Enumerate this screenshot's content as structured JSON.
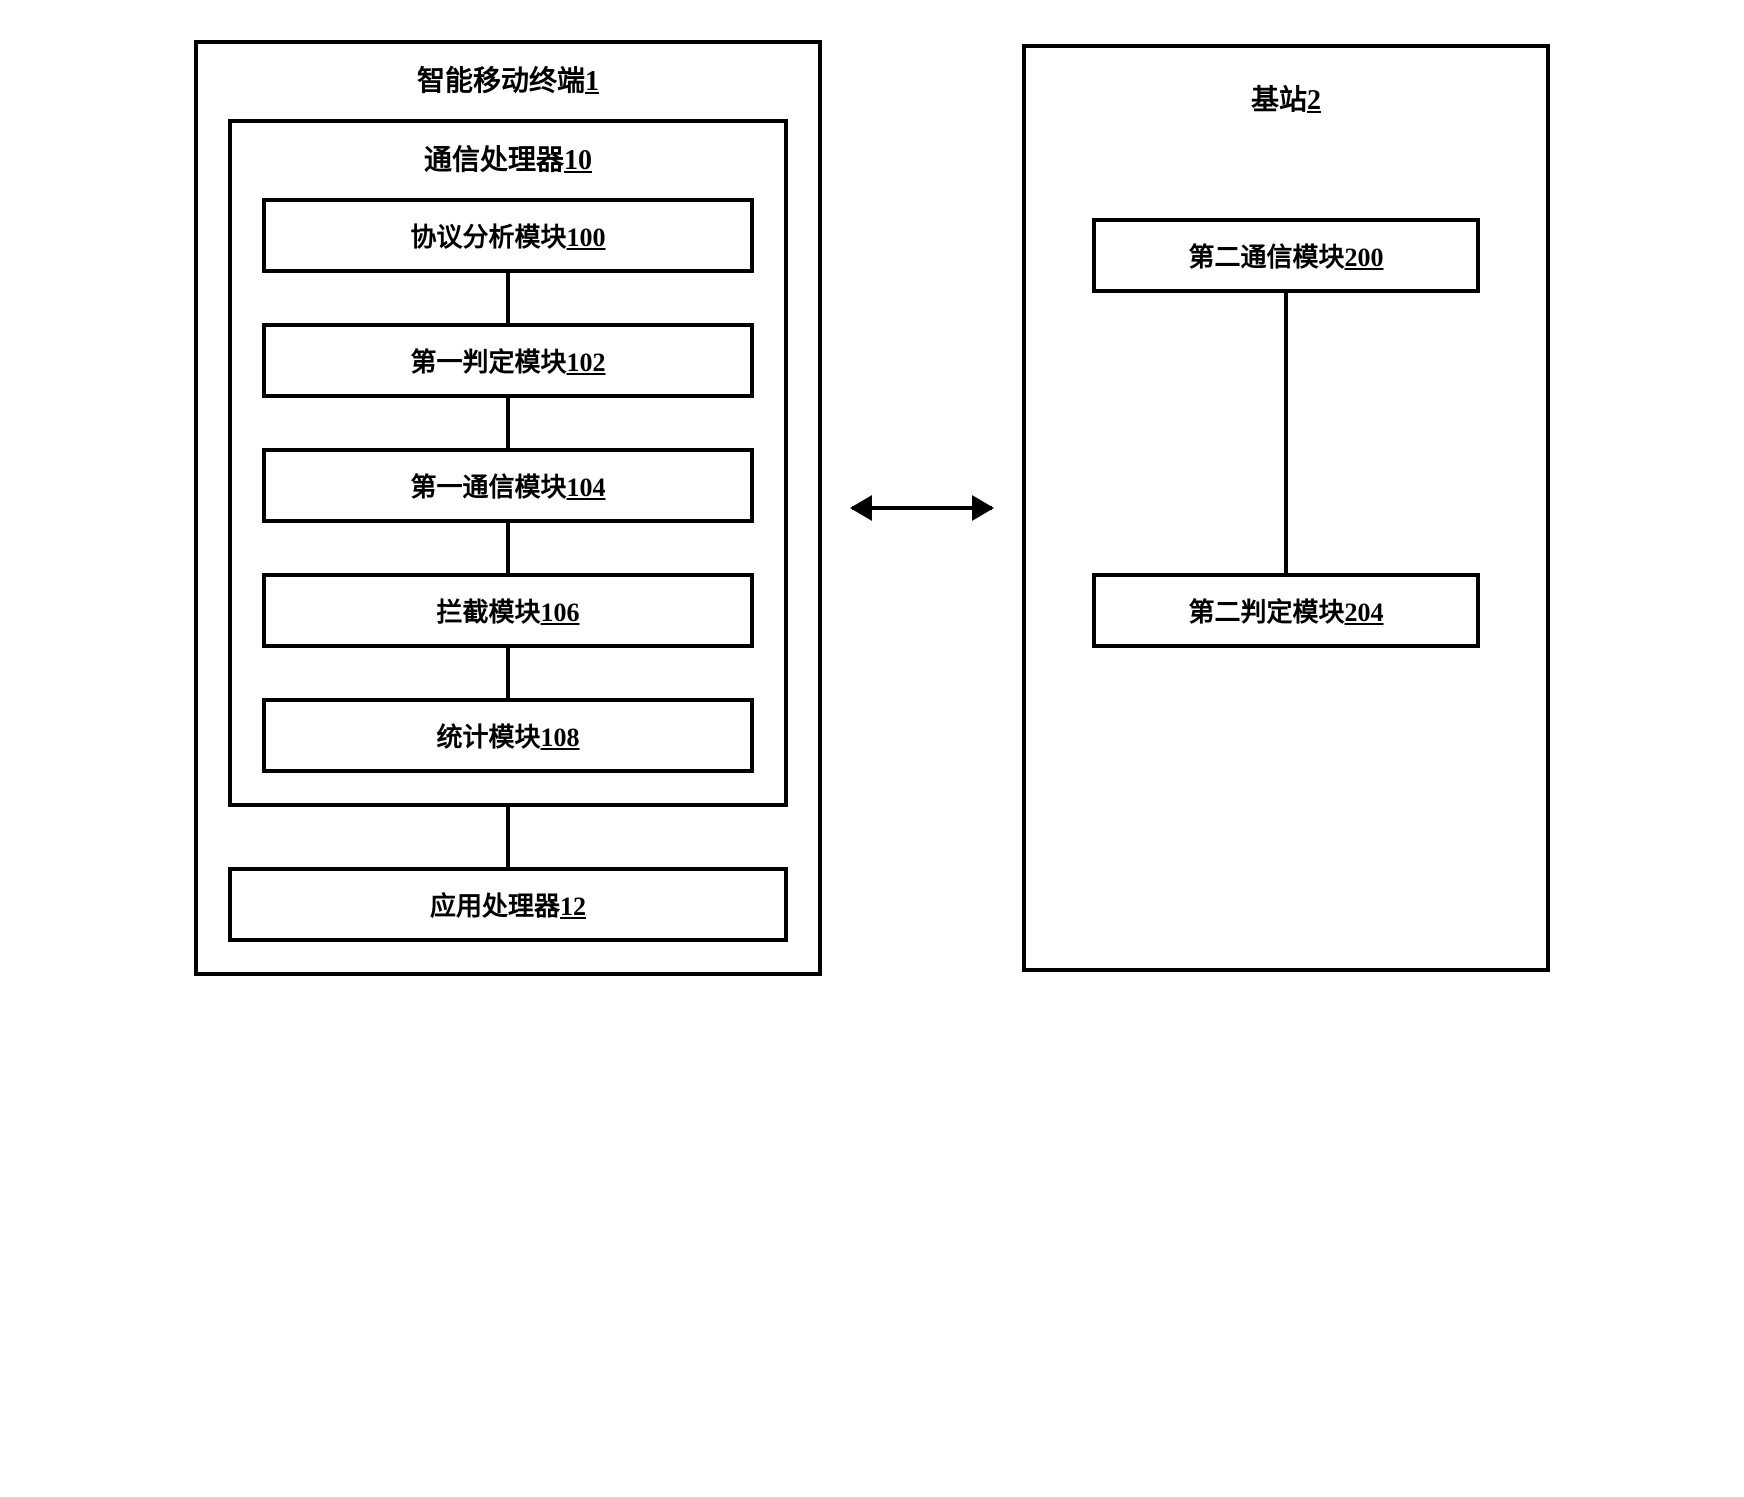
{
  "terminal": {
    "title": "智能移动终端",
    "title_num": "1",
    "processor": {
      "title": "通信处理器",
      "title_num": "10",
      "modules": [
        {
          "label": "协议分析模块",
          "num": "100"
        },
        {
          "label": "第一判定模块",
          "num": "102"
        },
        {
          "label": "第一通信模块",
          "num": "104"
        },
        {
          "label": "拦截模块",
          "num": "106"
        },
        {
          "label": "统计模块",
          "num": "108"
        }
      ]
    },
    "app_processor": {
      "label": "应用处理器",
      "num": "12"
    }
  },
  "station": {
    "title": "基站",
    "title_num": "2",
    "modules": [
      {
        "label": "第二通信模块",
        "num": "200"
      },
      {
        "label": "第二判定模块",
        "num": "204"
      }
    ]
  }
}
